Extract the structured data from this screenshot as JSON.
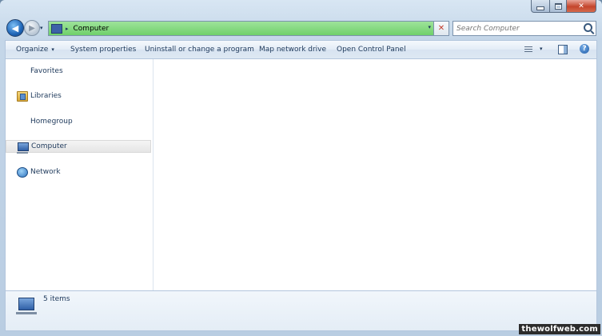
{
  "window": {
    "caption": {
      "minimize": "–",
      "maximize": "□",
      "close": "✕"
    }
  },
  "address_bar": {
    "breadcrumb": [
      "Computer"
    ],
    "separator": "▸",
    "dropdown": "▾",
    "refresh": "✕",
    "highlight_color": "#7ed67a"
  },
  "navigation": {
    "back": "◀",
    "forward": "▶",
    "history": "▾"
  },
  "search": {
    "placeholder": "Search Computer"
  },
  "command_bar": {
    "items": [
      {
        "label": "Organize",
        "has_dropdown": true
      },
      {
        "label": "System properties"
      },
      {
        "label": "Uninstall or change a program"
      },
      {
        "label": "Map network drive"
      },
      {
        "label": "Open Control Panel"
      }
    ],
    "dropdown_glyph": "▾",
    "help": "?"
  },
  "nav_pane": {
    "items": [
      {
        "label": "Favorites",
        "icon": "favorites-icon"
      },
      {
        "label": "Libraries",
        "icon": "libraries-icon"
      },
      {
        "label": "Homegroup",
        "icon": "homegroup-icon"
      },
      {
        "label": "Computer",
        "icon": "computer-icon",
        "selected": true
      },
      {
        "label": "Network",
        "icon": "network-icon"
      }
    ]
  },
  "details": {
    "summary": "5 items"
  },
  "watermark": {
    "text": "thewolfweb.com"
  }
}
